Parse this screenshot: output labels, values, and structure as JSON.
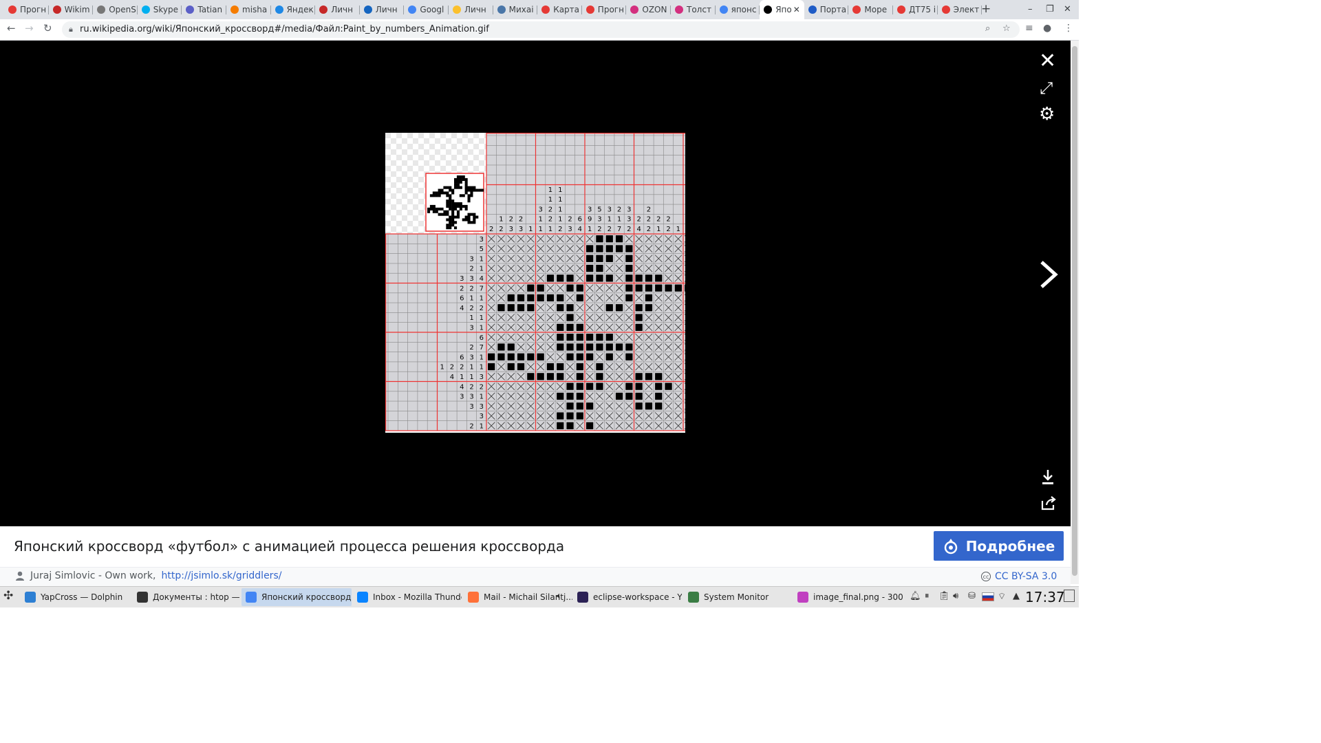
{
  "tabs": [
    {
      "label": "Прогн",
      "color": "#e53935"
    },
    {
      "label": "Wikim",
      "color": "#c62828"
    },
    {
      "label": "OpenS",
      "color": "#777777"
    },
    {
      "label": "Skype",
      "color": "#00aff0"
    },
    {
      "label": "Tatian",
      "color": "#5b5fc7"
    },
    {
      "label": "misha",
      "color": "#f57c00"
    },
    {
      "label": "Яндек",
      "color": "#1e88e5"
    },
    {
      "label": "Личн",
      "color": "#c62828"
    },
    {
      "label": "Личн",
      "color": "#1565c0"
    },
    {
      "label": "Googl",
      "color": "#4285f4"
    },
    {
      "label": "Личн",
      "color": "#fbc02d"
    },
    {
      "label": "Михаі",
      "color": "#4a76a8"
    },
    {
      "label": "Карта",
      "color": "#e53935"
    },
    {
      "label": "Прогн",
      "color": "#e53935"
    },
    {
      "label": "OZON",
      "color": "#d32f7f"
    },
    {
      "label": "Толст",
      "color": "#d32f7f"
    },
    {
      "label": "японс",
      "color": "#4285f4"
    },
    {
      "label": "Япо",
      "color": "#000000",
      "active": true
    },
    {
      "label": "Порта",
      "color": "#1e5bc6"
    },
    {
      "label": "Море",
      "color": "#e53935"
    },
    {
      "label": "ДТ75 і",
      "color": "#e53935"
    },
    {
      "label": "Элект",
      "color": "#e53935"
    }
  ],
  "browser": {
    "url": "ru.wikipedia.org/wiki/Японский_кроссворд#/media/Файл:Paint_by_numbers_Animation.gif"
  },
  "caption": {
    "title": "Японский кроссворд «футбол» с анимацией процесса решения кроссворда",
    "more_label": "Подробнее",
    "author": "Juraj Simlovic - Own work,",
    "author_link": "http://jsimlo.sk/griddlers/",
    "license": "CC BY-SA 3.0"
  },
  "puzzle": {
    "col_clues": [
      [
        "2"
      ],
      [
        "1",
        "2"
      ],
      [
        "2",
        "3"
      ],
      [
        "2",
        "3"
      ],
      [
        "1"
      ],
      [
        "3",
        "1",
        "1"
      ],
      [
        "1",
        "1",
        "2",
        "2",
        "1"
      ],
      [
        "1",
        "1",
        "1",
        "1",
        "2"
      ],
      [
        "2",
        "3"
      ],
      [
        "6",
        "4"
      ],
      [
        "3",
        "9",
        "1"
      ],
      [
        "5",
        "3",
        "2"
      ],
      [
        "3",
        "1",
        "2"
      ],
      [
        "2",
        "1",
        "7"
      ],
      [
        "3",
        "3",
        "2"
      ],
      [
        "2",
        "4"
      ],
      [
        "2",
        "2",
        "2"
      ],
      [
        "2",
        "1"
      ],
      [
        "2",
        "2"
      ],
      [
        "1"
      ],
      [
        "1"
      ]
    ],
    "row_clues": [
      [
        "3"
      ],
      [
        "5"
      ],
      [
        "3",
        "1"
      ],
      [
        "2",
        "1"
      ],
      [
        "3",
        "3",
        "4"
      ],
      [
        "2",
        "2",
        "7"
      ],
      [
        "6",
        "1",
        "1"
      ],
      [
        "4",
        "2",
        "2"
      ],
      [
        "1",
        "1"
      ],
      [
        "3",
        "1"
      ],
      [
        "6"
      ],
      [
        "2",
        "7"
      ],
      [
        "6",
        "3",
        "1"
      ],
      [
        "1",
        "2",
        "2",
        "1",
        "1"
      ],
      [
        "4",
        "1",
        "1",
        "3"
      ],
      [
        "4",
        "2",
        "2"
      ],
      [
        "3",
        "3",
        "1"
      ],
      [
        "3",
        "3"
      ],
      [
        "3"
      ],
      [
        "2",
        "1"
      ]
    ],
    "grid": [
      "...........XXX.......",
      "..........XXXXX......",
      "..........XXX.X......",
      "..........XX..X......",
      "......XXX.XXX.XXXX...",
      "....XX..XX....XXXXXXX",
      "..XXXXXX.X....X.X....",
      ".XXXX..XX...XX.XX....",
      "........X......X.....",
      ".......XXX.....X.....",
      ".......XXXXXX........",
      ".XX....XXXXXXXX......",
      "XXXXXX..XXX.X.X......",
      "X.XX..XX.X.X.........",
      "....XXXX.X.X...XXX...",
      "........XXXX..XX.XX..",
      ".......XXX...XXX.X...",
      "........XXX....XXX...",
      ".......XXX...........",
      ".......XX.X.........."
    ]
  },
  "taskbar": [
    {
      "label": "YapCross — Dolphin",
      "color": "#2d7fd3"
    },
    {
      "label": "Документы : htop — Ko...",
      "color": "#333333"
    },
    {
      "label": "Японский кроссворд —...",
      "color": "#4285f4",
      "active": true
    },
    {
      "label": "Inbox - Mozilla Thunder...",
      "color": "#0a84ff"
    },
    {
      "label": "Mail - Michail Silantj...",
      "color": "#ff7139"
    },
    {
      "label": "eclipse-workspace - YapC...",
      "color": "#2c2255"
    },
    {
      "label": "System Monitor",
      "color": "#3a7d44"
    },
    {
      "label": "image_final.png - 300x3...",
      "color": "#c040c0"
    }
  ],
  "clock": "17:37"
}
